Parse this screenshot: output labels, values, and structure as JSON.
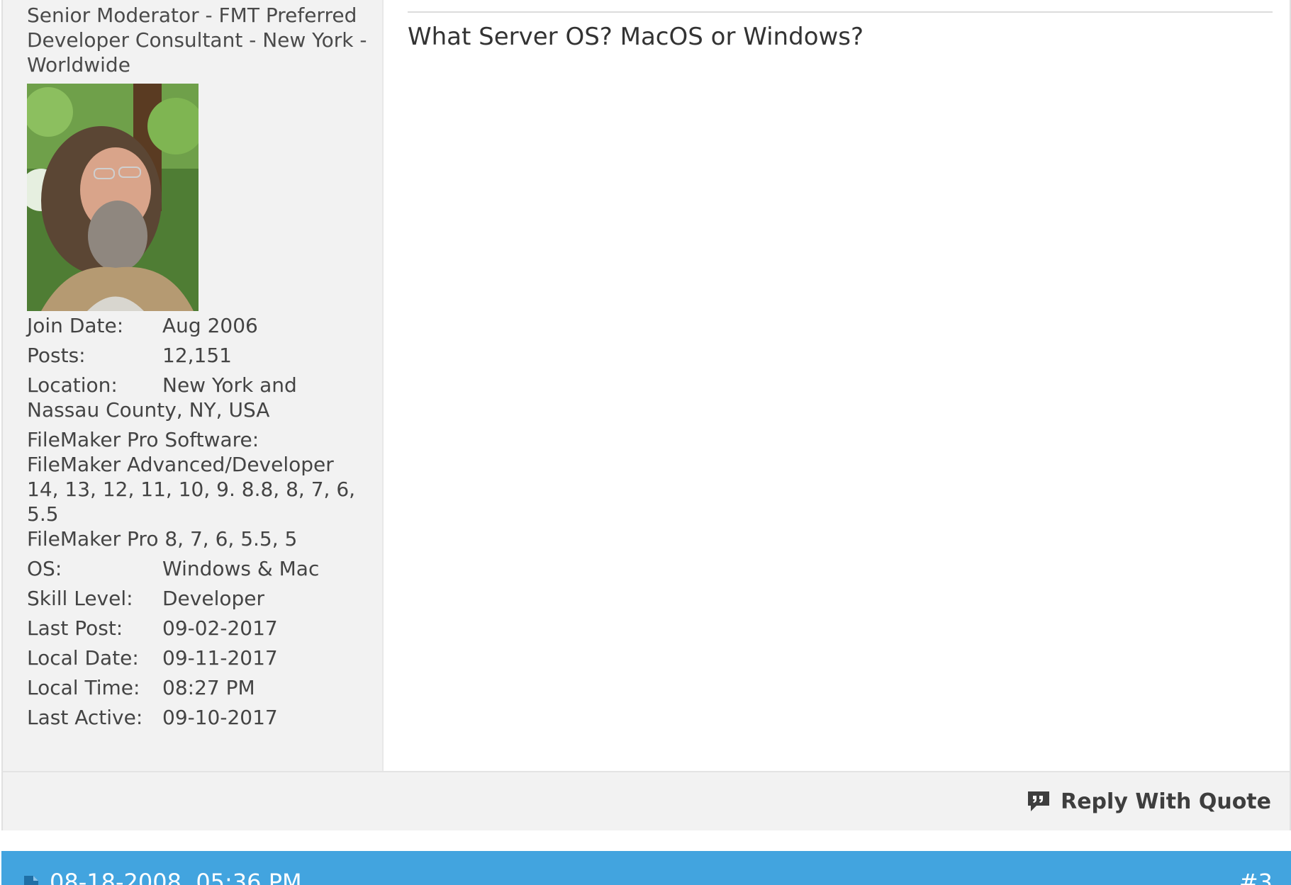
{
  "post": {
    "user_title": "Senior Moderator - FMT Preferred Developer Consultant - New York - Worldwide",
    "avatar": "user-photo",
    "stats": {
      "join_date_label": "Join Date:",
      "join_date": "Aug 2006",
      "posts_label": "Posts:",
      "posts": "12,151",
      "location_label": "Location:",
      "location_line1": "New York and",
      "location_line2": "Nassau County, NY, USA",
      "software_label": "FileMaker Pro Software:",
      "software_line1": "FileMaker Advanced/Developer",
      "software_line2": "14, 13, 12, 11, 10, 9. 8.8, 8, 7, 6, 5.5",
      "software_line3": "FileMaker Pro 8, 7, 6, 5.5, 5",
      "os_label": "OS:",
      "os": "Windows & Mac",
      "skill_label": "Skill Level:",
      "skill": "Developer",
      "last_post_label": "Last Post:",
      "last_post": "09-02-2017",
      "local_date_label": "Local Date:",
      "local_date": "09-11-2017",
      "local_time_label": "Local Time:",
      "local_time": "08:27 PM",
      "last_active_label": "Last Active:",
      "last_active": "09-10-2017"
    },
    "message": "What Server OS? MacOS or Windows?",
    "reply_with_quote": "Reply With Quote"
  },
  "next_post": {
    "date": "08-18-2008, 05:36 PM",
    "number": "#3"
  },
  "colors": {
    "header_blue": "#42a4df",
    "sidebar_bg": "#f2f2f2"
  }
}
